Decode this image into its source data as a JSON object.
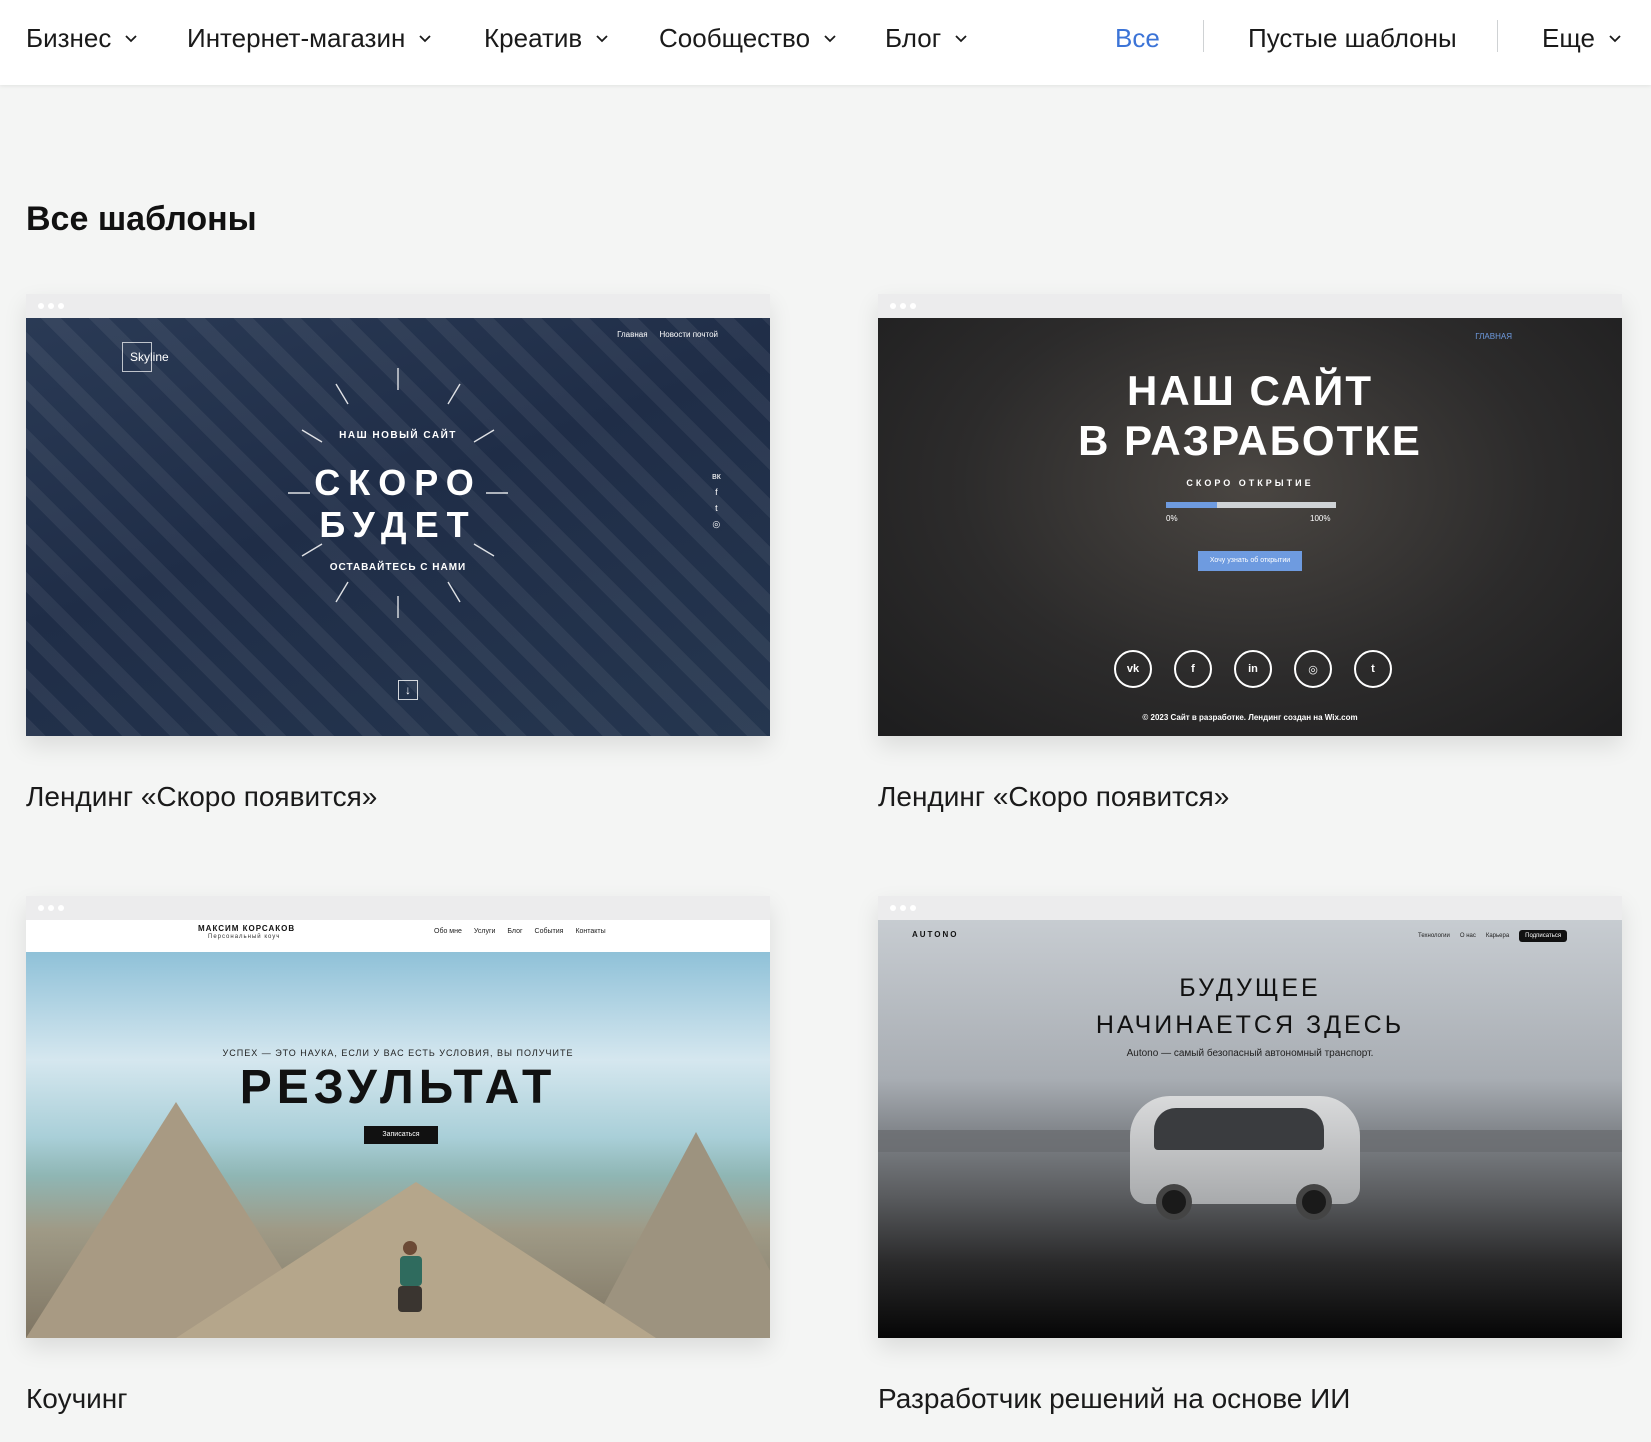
{
  "nav": {
    "items": [
      {
        "label": "Бизнес"
      },
      {
        "label": "Интернет-магазин"
      },
      {
        "label": "Креатив"
      },
      {
        "label": "Сообщество"
      },
      {
        "label": "Блог"
      }
    ],
    "all_label": "Все",
    "blank_label": "Пустые шаблоны",
    "more_label": "Еще",
    "active_color": "#3c74d7"
  },
  "section_title": "Все шаблоны",
  "templates": [
    {
      "title": "Лендинг «Скоро появится»",
      "preview": {
        "logo": "Skyline",
        "menu": [
          "Главная",
          "Новости почтой"
        ],
        "pretitle": "НАШ НОВЫЙ САЙТ",
        "headline_1": "СКОРО",
        "headline_2": "БУДЕТ",
        "posttitle": "ОСТАВАЙТЕСЬ С НАМИ",
        "social": [
          "вк",
          "f",
          "t",
          "◎"
        ],
        "down_arrow": "↓"
      }
    },
    {
      "title": "Лендинг «Скоро появится»",
      "preview": {
        "menu": "ГЛАВНАЯ",
        "headline_1": "НАШ САЙТ",
        "headline_2": "В РАЗРАБОТКЕ",
        "soon": "СКОРО ОТКРЫТИЕ",
        "progress_percent": 30,
        "progress_left": "0%",
        "progress_right": "100%",
        "button": "Хочу узнать об открытии",
        "social": [
          "vk",
          "f",
          "in",
          "◎",
          "t"
        ],
        "footer": "© 2023 Сайт в разработке. Лендинг создан на Wix.com",
        "accent_color": "#6e9be0"
      }
    },
    {
      "title": "Коучинг",
      "preview": {
        "name": "МАКСИМ КОРСАКОВ",
        "subtitle": "Персональный коуч",
        "menu": [
          "Обо мне",
          "Услуги",
          "Блог",
          "События",
          "Контакты"
        ],
        "pretitle": "УСПЕХ — ЭТО НАУКА, ЕСЛИ У ВАС ЕСТЬ УСЛОВИЯ, ВЫ ПОЛУЧИТЕ",
        "headline": "РЕЗУЛЬТАТ",
        "button": "Записаться"
      }
    },
    {
      "title": "Разработчик решений на основе ИИ",
      "preview": {
        "logo": "AUTONO",
        "menu": [
          "Технологии",
          "О нас",
          "Карьера"
        ],
        "cta": "Подписаться",
        "headline_1": "БУДУЩЕЕ",
        "headline_2": "НАЧИНАЕТСЯ ЗДЕСЬ",
        "subtitle": "Autono — самый безопасный автономный транспорт."
      }
    }
  ]
}
